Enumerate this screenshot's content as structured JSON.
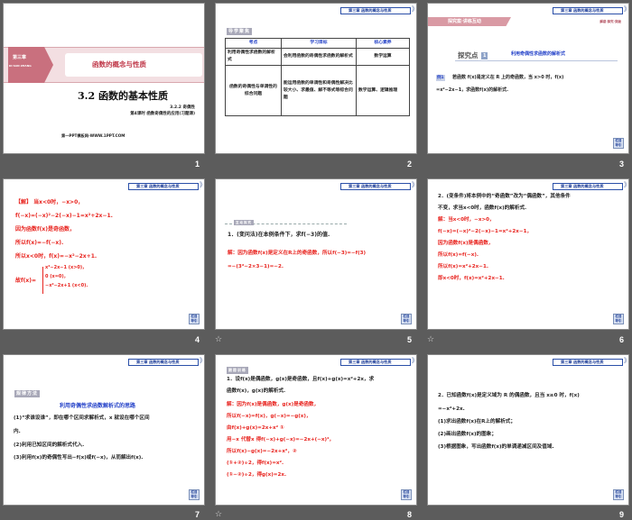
{
  "chapter_tag": "第三章 函数的概念与性质",
  "back_button": "栏目导引",
  "slides": [
    {
      "number": "1",
      "chapter": "第三章",
      "chapter_pinyin": "DI SAN ZHANG",
      "banner": "函数的概念与性质",
      "title": "3.2 函数的基本性质",
      "sub1": "3.2.2 奇偶性",
      "sub2": "第4课时 函数奇偶性的应用(习题课)",
      "site": "第一PPT模板网-WWW.1PPT.COM"
    },
    {
      "number": "2",
      "label": "导学聚焦",
      "headers": [
        "考点",
        "学习目标",
        "核心素养"
      ],
      "rows": [
        [
          "利用奇偶性求函数的解析式",
          "会利用函数的奇偶性求函数的解析式",
          "数学运算"
        ],
        [
          "函数的奇偶性与单调性的综合问题",
          "能运用函数的单调性和奇偶性解决比较大小、求最值、解不等式等综合问题",
          "数学运算、逻辑推理"
        ]
      ]
    },
    {
      "number": "3",
      "section": "探究案·讲练互动",
      "section_right": "解惑·探究·突破",
      "point": "探究点",
      "point_no": "1",
      "point_title": "利用奇偶性求函数的解析式",
      "example": "例1",
      "lines": [
        "若函数 f(x)是定义在 R 上的奇函数，当 x>0 时，f(x)",
        "=x²−2x−1，求函数f(x)的解析式."
      ]
    },
    {
      "number": "4",
      "lines": [
        "【解】 当x<0时，−x>0，",
        "f(−x)=(−x)²−2(−x)−1=x²+2x−1.",
        "因为函数f(x)是奇函数，",
        "所以f(x)=−f(−x).",
        "所以x<0时，f(x)=−x²−2x+1."
      ],
      "piece_prefix": "故f(x)=",
      "pieces": [
        "x²−2x−1 (x>0)，",
        "0 (x=0)，",
        "−x²−2x+1 (x<0)."
      ]
    },
    {
      "number": "5",
      "label": "互动探究",
      "lines": [
        "1．(变问法)在本例条件下，求f(−3)的值."
      ],
      "answer": [
        "解：因为函数f(x)是定义在R上的奇函数，所以f(−3)=−f(3)",
        "=−(3²−2×3−1)=−2."
      ]
    },
    {
      "number": "6",
      "lines": [
        "2．(变条件)将本例中的“奇函数”改为“偶函数”，其他条件",
        "不变，求当x<0时，函数f(x)的解析式."
      ],
      "answer": [
        "解：当x<0时，−x>0，",
        "f(−x)=(−x)²−2(−x)−1=x²+2x−1，",
        "因为函数f(x)是偶函数，",
        "所以f(x)=f(−x).",
        "所以f(x)=x²+2x−1.",
        "即x<0时，f(x)=x²+2x−1."
      ]
    },
    {
      "number": "7",
      "label": "规律方法",
      "heading": "利用奇偶性求函数解析式的思路",
      "lines": [
        "(1)“求谁设谁”，即在哪个区间求解析式，x 就设在哪个区间",
        "内.",
        "(2)利用已知区间的解析式代入.",
        "(3)利用f(x)的奇偶性写出−f(x)或f(−x)，从而解出f(x)."
      ]
    },
    {
      "number": "8",
      "label": "跟踪训练",
      "lines": [
        "1．设f(x)是偶函数，g(x)是奇函数，且f(x)+g(x)=x²+2x，求",
        "函数f(x)，g(x)的解析式."
      ],
      "answer": [
        "解：因为f(x)是偶函数，g(x)是奇函数，",
        "所以f(−x)=f(x)，g(−x)=−g(x)，",
        "由f(x)+g(x)=2x+x² ①",
        "用−x 代替x 得f(−x)+g(−x)=−2x+(−x)²，",
        "所以f(x)−g(x)=−2x+x²，②",
        "(①+②)÷2，得f(x)=x².",
        "(①−②)÷2，得g(x)=2x."
      ]
    },
    {
      "number": "9",
      "lines": [
        "2．已知函数f(x)是定义域为 R 的偶函数，且当 x≥0 时，f(x)",
        "=−x²+2x.",
        "(1)求出函数f(x)在R上的解析式；",
        "(2)画出函数f(x)的图象；",
        "(3)根据图象，写出函数f(x)的单调递减区间及值域."
      ]
    }
  ]
}
